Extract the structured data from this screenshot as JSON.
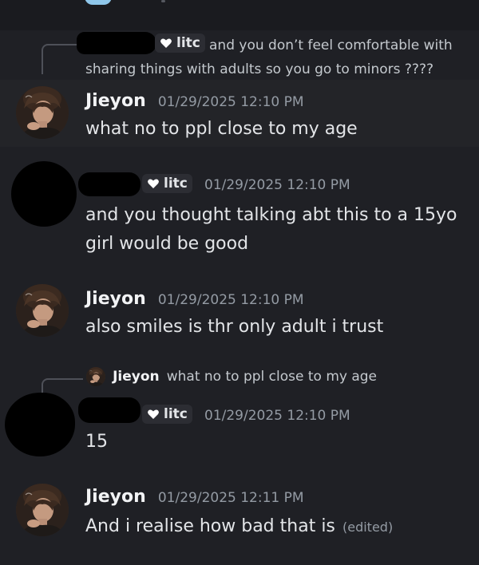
{
  "messages": [
    {
      "reply": {
        "tag": "litc",
        "text": "and you don’t feel comfortable with sharing things with adults so you go to minors ????"
      }
    },
    {
      "author": "Jieyon",
      "timestamp": "01/29/2025 12:10 PM",
      "content": "what no to ppl close to my age"
    },
    {
      "tag": "litc",
      "timestamp": "01/29/2025 12:10 PM",
      "content_line1": "and you thought talking abt this to a 15yo",
      "content_line2": "girl would be good"
    },
    {
      "author": "Jieyon",
      "timestamp": "01/29/2025 12:10 PM",
      "content": "also smiles is thr only adult i trust"
    },
    {
      "reply": {
        "author": "Jieyon",
        "text": "what no to ppl close to my age"
      },
      "tag": "litc",
      "timestamp": "01/29/2025 12:10 PM",
      "content": "15"
    },
    {
      "author": "Jieyon",
      "timestamp": "01/29/2025 12:11 PM",
      "content": "And i realise how bad that is",
      "edited": "(edited)"
    }
  ],
  "colors": {
    "background": "#1f2025",
    "highlight": "#232428",
    "username": "#f2f3f5",
    "timestamp": "#949ba4",
    "text": "#e3e5e8"
  },
  "icons": [
    "heart-icon",
    "avatar"
  ]
}
